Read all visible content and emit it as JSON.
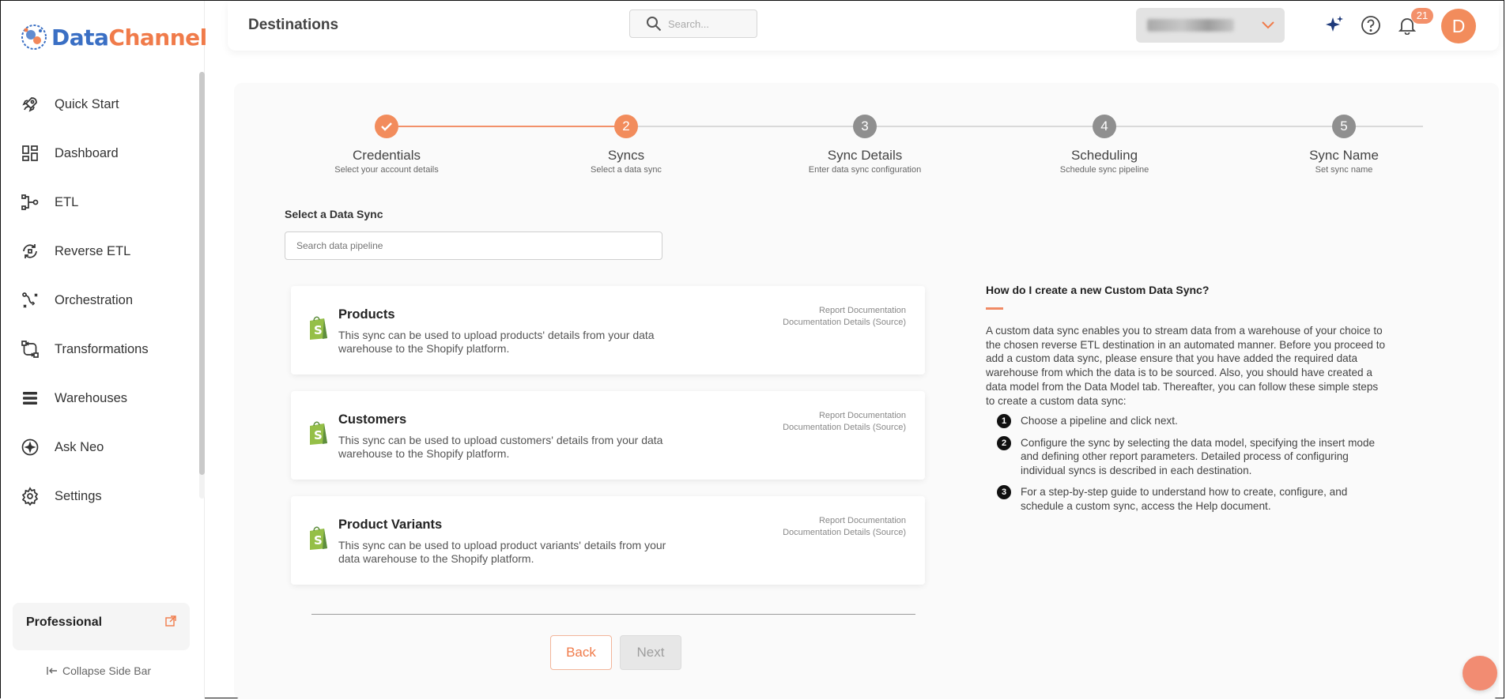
{
  "app": {
    "logo_text_a": "Data",
    "logo_text_b": "Channel"
  },
  "sidebar": {
    "items": [
      {
        "label": "Quick Start",
        "icon": "rocket-icon"
      },
      {
        "label": "Dashboard",
        "icon": "dashboard-grid-icon"
      },
      {
        "label": "ETL",
        "icon": "etl-flow-icon"
      },
      {
        "label": "Reverse ETL",
        "icon": "reverse-etl-icon"
      },
      {
        "label": "Orchestration",
        "icon": "orchestration-icon"
      },
      {
        "label": "Transformations",
        "icon": "transformations-icon"
      },
      {
        "label": "Warehouses",
        "icon": "warehouse-stack-icon"
      },
      {
        "label": "Ask Neo",
        "icon": "sparkle-box-icon"
      },
      {
        "label": "Settings",
        "icon": "gear-icon"
      }
    ],
    "plan_name": "Professional",
    "collapse_label": "Collapse Side Bar"
  },
  "header": {
    "title": "Destinations",
    "search_placeholder": "Search...",
    "notification_count": "21",
    "avatar_initial": "D"
  },
  "stepper": {
    "steps": [
      {
        "number": "1",
        "title": "Credentials",
        "subtitle": "Select your account details",
        "state": "done"
      },
      {
        "number": "2",
        "title": "Syncs",
        "subtitle": "Select a data sync",
        "state": "active"
      },
      {
        "number": "3",
        "title": "Sync Details",
        "subtitle": "Enter data sync configuration",
        "state": "pending"
      },
      {
        "number": "4",
        "title": "Scheduling",
        "subtitle": "Schedule sync pipeline",
        "state": "pending"
      },
      {
        "number": "5",
        "title": "Sync Name",
        "subtitle": "Set sync name",
        "state": "pending"
      }
    ]
  },
  "sync_select": {
    "label": "Select a Data Sync",
    "search_placeholder": "Search data pipeline"
  },
  "syncs": [
    {
      "title": "Products",
      "description": "This sync can be used to upload products' details from your data warehouse to the Shopify platform.",
      "link_report": "Report Documentation",
      "link_details": "Documentation Details (Source)"
    },
    {
      "title": "Customers",
      "description": "This sync can be used to upload customers' details from your data warehouse to the Shopify platform.",
      "link_report": "Report Documentation",
      "link_details": "Documentation Details (Source)"
    },
    {
      "title": "Product Variants",
      "description": "This sync can be used to upload product variants' details from your data warehouse to the Shopify platform.",
      "link_report": "Report Documentation",
      "link_details": "Documentation Details (Source)"
    }
  ],
  "buttons": {
    "back": "Back",
    "next": "Next"
  },
  "help": {
    "heading": "How do I create a new Custom Data Sync?",
    "paragraph": "A custom data sync enables you to stream data from a warehouse of your choice to the chosen reverse ETL destination in an automated manner. Before you proceed to add a custom data sync, please ensure that you have added the required data warehouse from which the data is to be sourced. Also, you should have created a data model from the Data Model tab. Thereafter, you can follow these simple steps to create a custom data sync:",
    "steps": [
      {
        "num": "1",
        "text": "Choose a pipeline and click next."
      },
      {
        "num": "2",
        "text": "Configure the sync by selecting the data model, specifying the insert mode and defining other report parameters. Detailed process of configuring individual syncs is described in each destination."
      },
      {
        "num": "3",
        "text": "For a step-by-step guide to understand how to create, configure, and schedule a custom sync, access the Help document."
      }
    ]
  },
  "colors": {
    "accent": "#f07b4a",
    "step_done": "#f28c5c",
    "step_pending": "#8f8f8f",
    "shopify_green": "#95bf47"
  }
}
